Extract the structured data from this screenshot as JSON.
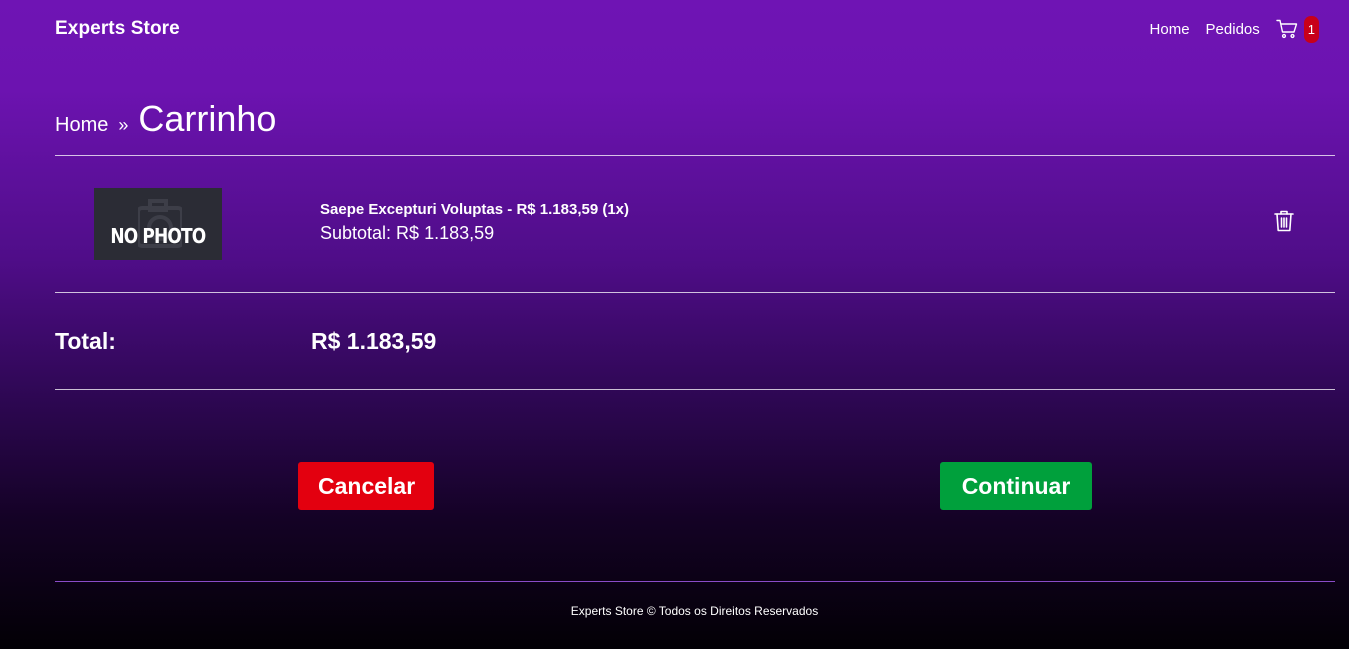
{
  "navbar": {
    "brand": "Experts Store",
    "links": [
      "Home",
      "Pedidos"
    ],
    "cart_icon": "cart-icon",
    "cart_count": "1",
    "badge_color": "#c8001a"
  },
  "breadcrumb": {
    "home": "Home",
    "separator": "»",
    "current": "Carrinho"
  },
  "cart": {
    "items": [
      {
        "image_text": "NO PHOTO",
        "name": "Saepe Excepturi Voluptas - R$ 1.183,59 (1x)",
        "subtotal": "Subtotal: R$ 1.183,59",
        "remove_icon": "trash-icon"
      }
    ],
    "total_label": "Total:",
    "total_value": "R$ 1.183,59"
  },
  "actions": {
    "cancel_label": "Cancelar",
    "cancel_color": "#e3000f",
    "continue_label": "Continuar",
    "continue_color": "#00a03c"
  },
  "footer": {
    "text": "Experts Store © Todos os Direitos Reservados"
  }
}
